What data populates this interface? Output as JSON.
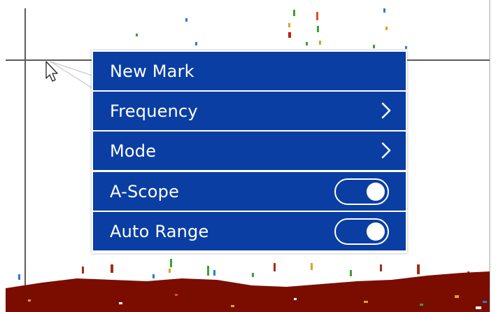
{
  "colors": {
    "menu_bg": "#0a3ea3",
    "menu_text": "#ffffff",
    "seabed": "#7a0d00"
  },
  "context_menu": {
    "items": [
      {
        "label": "New Mark",
        "control": "none"
      },
      {
        "label": "Frequency",
        "control": "chevron-right-icon"
      },
      {
        "label": "Mode",
        "control": "chevron-right-icon"
      },
      {
        "label": "A-Scope",
        "control": "toggle",
        "state": "on"
      },
      {
        "label": "Auto Range",
        "control": "toggle",
        "state": "on"
      }
    ]
  }
}
